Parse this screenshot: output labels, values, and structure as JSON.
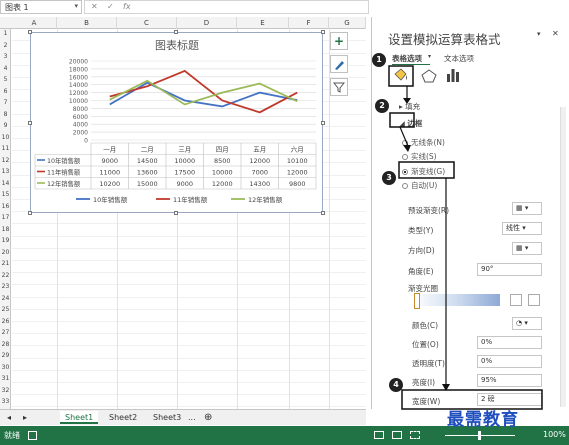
{
  "namebox": {
    "value": "图表 1"
  },
  "formula_bar": {
    "cancel": "✕",
    "confirm": "✓",
    "fx": "fx"
  },
  "columns": [
    "A",
    "B",
    "C",
    "D",
    "E",
    "F",
    "G"
  ],
  "rows": [
    "1",
    "2",
    "3",
    "4",
    "5",
    "6",
    "7",
    "8",
    "9",
    "10",
    "11",
    "12",
    "13",
    "14",
    "15",
    "16",
    "17",
    "18",
    "19",
    "20",
    "21",
    "22",
    "23",
    "24",
    "25",
    "26",
    "27",
    "28",
    "29",
    "30",
    "31",
    "32",
    "33"
  ],
  "chart": {
    "title": "图表标题",
    "yticks": [
      "20000",
      "18000",
      "16000",
      "14000",
      "12000",
      "10000",
      "8000",
      "6000",
      "4000",
      "2000",
      "0"
    ]
  },
  "chart_data": {
    "type": "line",
    "title": "图表标题",
    "categories": [
      "一月",
      "二月",
      "三月",
      "四月",
      "五月",
      "六月"
    ],
    "ylim": [
      0,
      20000
    ],
    "series": [
      {
        "name": "10年销售额",
        "values": [
          9000,
          14500,
          10000,
          8500,
          12000,
          10100
        ],
        "color": "#4472c4"
      },
      {
        "name": "11年销售额",
        "values": [
          11000,
          13600,
          17500,
          10000,
          7000,
          12000
        ],
        "color": "#c0392b"
      },
      {
        "name": "12年销售额",
        "values": [
          10200,
          15000,
          9000,
          12000,
          14300,
          9800
        ],
        "color": "#9bbb59"
      }
    ],
    "legend": "bottom",
    "table_below": true
  },
  "sheet_tabs": {
    "nav_prev": "◂",
    "nav_next": "▸",
    "tabs": [
      "Sheet1",
      "Sheet2",
      "Sheet3"
    ],
    "more": "...",
    "add": "⊕"
  },
  "status": {
    "ready": "就绪",
    "zoom": "100%"
  },
  "panel": {
    "title": "设置模拟运算表格式",
    "tab_table_options": "表格选项",
    "tab_text_options": "文本选项",
    "close": "✕",
    "section_fill": "填充",
    "section_border": "边框",
    "options": [
      "无线条(N)",
      "实线(S)",
      "渐变线(G)",
      "自动(U)"
    ],
    "fields": [
      {
        "label": "预设渐变(R)",
        "value": ""
      },
      {
        "label": "类型(Y)",
        "value": "线性"
      },
      {
        "label": "方向(D)",
        "value": ""
      },
      {
        "label": "角度(E)",
        "value": "90°"
      },
      {
        "label": "渐变光圈",
        "value": ""
      },
      {
        "label": "颜色(C)",
        "value": ""
      },
      {
        "label": "位置(O)",
        "value": "0%"
      },
      {
        "label": "透明度(T)",
        "value": "0%"
      },
      {
        "label": "亮度(I)",
        "value": "95%"
      },
      {
        "label": "宽度(W)",
        "value": "2 磅"
      }
    ]
  },
  "callouts": [
    "1",
    "2",
    "3",
    "4"
  ],
  "watermark": "最需教育",
  "colors": {
    "excel_green": "#217346",
    "accent": "#1f4fbf"
  }
}
